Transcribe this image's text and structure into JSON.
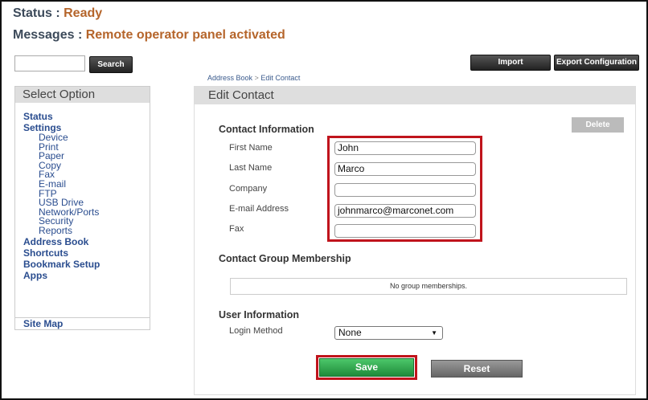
{
  "status": {
    "label": "Status :",
    "value": "Ready"
  },
  "messages": {
    "label": "Messages :",
    "value": "Remote operator panel activated"
  },
  "search": {
    "value": "",
    "button_label": "Search"
  },
  "toolbar": {
    "import_label": "Import Configuration",
    "export_label": "Export Configuration"
  },
  "breadcrumb": {
    "root": "Address Book",
    "separator": ">",
    "current": "Edit Contact"
  },
  "sidebar": {
    "title": "Select Option",
    "items": [
      {
        "label": "Status",
        "level": "top"
      },
      {
        "label": "Settings",
        "level": "top"
      },
      {
        "label": "Device",
        "level": "sub"
      },
      {
        "label": "Print",
        "level": "sub"
      },
      {
        "label": "Paper",
        "level": "sub"
      },
      {
        "label": "Copy",
        "level": "sub"
      },
      {
        "label": "Fax",
        "level": "sub"
      },
      {
        "label": "E-mail",
        "level": "sub"
      },
      {
        "label": "FTP",
        "level": "sub"
      },
      {
        "label": "USB Drive",
        "level": "sub"
      },
      {
        "label": "Network/Ports",
        "level": "sub"
      },
      {
        "label": "Security",
        "level": "sub"
      },
      {
        "label": "Reports",
        "level": "sub"
      },
      {
        "label": "Address Book",
        "level": "top"
      },
      {
        "label": "Shortcuts",
        "level": "top"
      },
      {
        "label": "Bookmark Setup",
        "level": "top"
      },
      {
        "label": "Apps",
        "level": "top"
      }
    ],
    "site_map": "Site Map"
  },
  "main": {
    "title": "Edit Contact",
    "delete_label": "Delete",
    "contact_info": {
      "heading": "Contact Information",
      "fields": {
        "first_name": {
          "label": "First Name",
          "value": "John"
        },
        "last_name": {
          "label": "Last Name",
          "value": "Marco"
        },
        "company": {
          "label": "Company",
          "value": ""
        },
        "email": {
          "label": "E-mail Address",
          "value": "johnmarco@marconet.com"
        },
        "fax": {
          "label": "Fax",
          "value": ""
        }
      }
    },
    "group_membership": {
      "heading": "Contact Group Membership",
      "empty_text": "No group memberships."
    },
    "user_info": {
      "heading": "User Information",
      "login_label": "Login Method",
      "login_value": "None"
    },
    "save_label": "Save",
    "reset_label": "Reset"
  },
  "colors": {
    "status_value": "#b5652b",
    "link": "#2a4d8f",
    "highlight": "#c0141c",
    "save": "#2ea84c"
  }
}
